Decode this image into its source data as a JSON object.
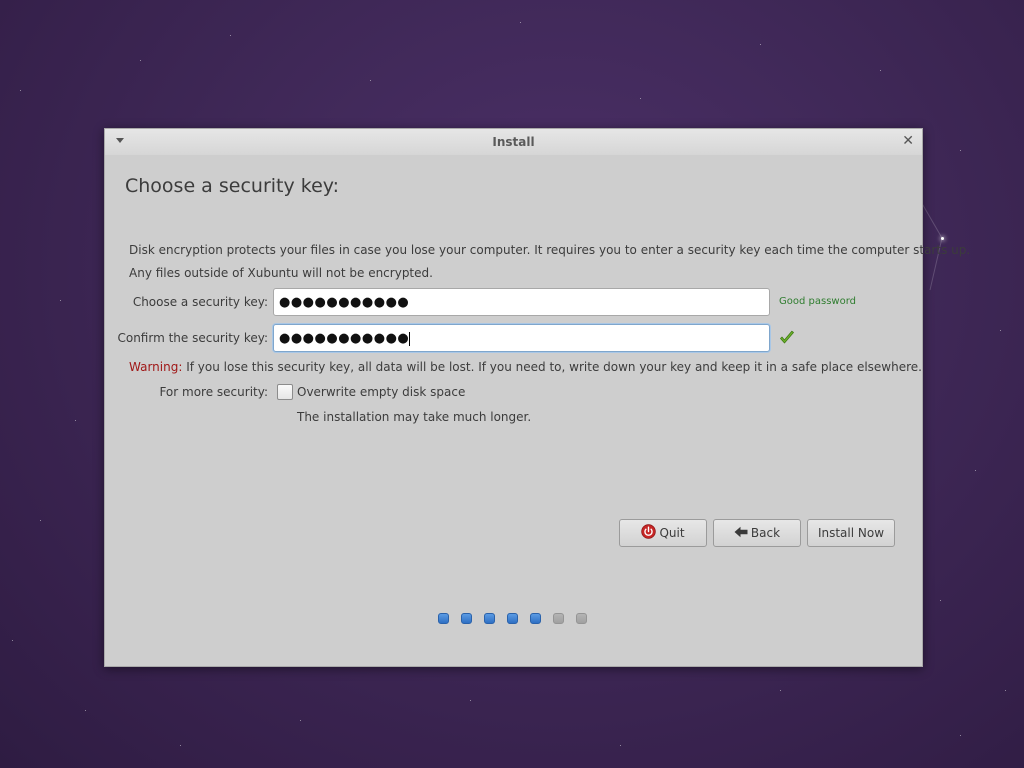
{
  "window": {
    "title": "Install"
  },
  "page": {
    "heading": "Choose a security key:",
    "description_line1": "Disk encryption protects your files in case you lose your computer. It requires you to enter a security key each time the computer starts up.",
    "description_line2": "Any files outside of Xubuntu will not be encrypted."
  },
  "form": {
    "security_key": {
      "label": "Choose a security key:",
      "value": "●●●●●●●●●●●",
      "strength": "Good password"
    },
    "confirm_key": {
      "label": "Confirm the security key:",
      "value": "●●●●●●●●●●●",
      "match_icon": "checkmark-icon"
    },
    "warning_label": "Warning:",
    "warning_text": " If you lose this security key, all data will be lost. If you need to, write down your key and keep it in a safe place elsewhere.",
    "more_security": {
      "label": "For more security:",
      "option_label": "Overwrite empty disk space",
      "checked": false,
      "note": "The installation may take much longer."
    }
  },
  "buttons": {
    "quit": "Quit",
    "back": "Back",
    "install_now": "Install Now"
  },
  "progress": {
    "total_steps": 7,
    "completed_steps": 5
  },
  "colors": {
    "window_bg": "#cecece",
    "warning": "#a01818",
    "good_password": "#2f7d2f",
    "step_done": "#3b80d4",
    "step_todo": "#a8a8a8"
  }
}
